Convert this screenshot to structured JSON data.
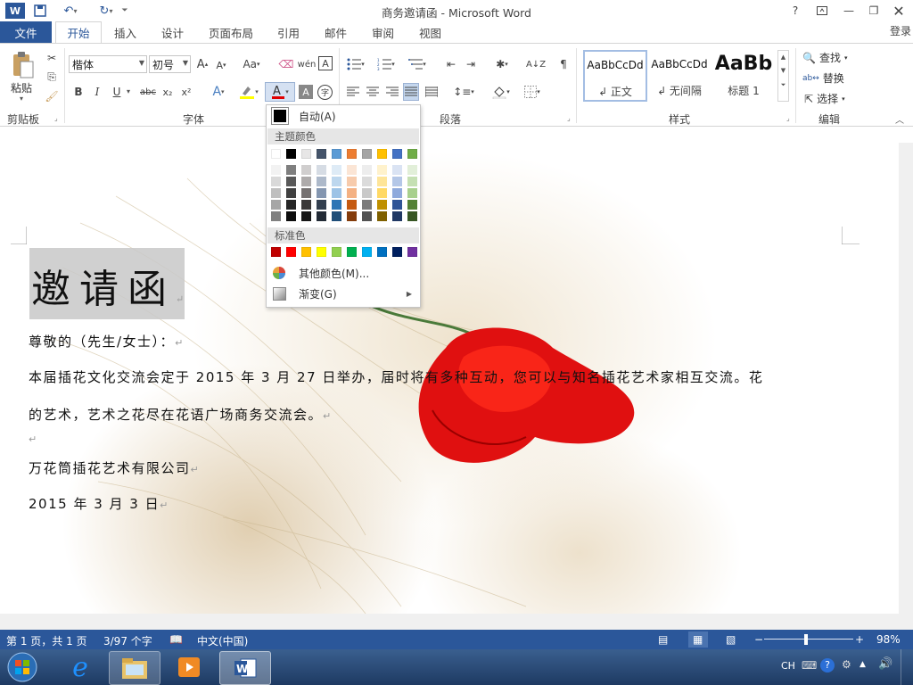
{
  "window": {
    "title": "商务邀请函 - Microsoft Word",
    "quick_access": [
      "W",
      "save",
      "undo",
      "redo",
      "customize"
    ],
    "controls": [
      "?",
      "restore-ribbon",
      "minimize",
      "maximize",
      "close"
    ]
  },
  "tabs": {
    "file": "文件",
    "items": [
      "开始",
      "插入",
      "设计",
      "页面布局",
      "引用",
      "邮件",
      "审阅",
      "视图"
    ],
    "login": "登录"
  },
  "ribbon": {
    "clipboard": {
      "label": "剪贴板",
      "paste": "粘贴"
    },
    "font": {
      "label": "字体",
      "font_name": "楷体",
      "font_size": "初号",
      "grow": "A",
      "shrink": "A",
      "change_case": "Aa",
      "bold": "B",
      "italic": "I",
      "underline": "U",
      "strike": "abc",
      "subscript": "x₂",
      "superscript": "x²"
    },
    "paragraph": {
      "label": "段落"
    },
    "styles": {
      "label": "样式",
      "items": [
        {
          "sample": "AaBbCcDd",
          "name": "↲ 正文"
        },
        {
          "sample": "AaBbCcDd",
          "name": "↲ 无间隔"
        },
        {
          "sample": "AaBb",
          "name": "标题 1"
        }
      ]
    },
    "editing": {
      "label": "编辑",
      "find": "查找",
      "replace": "替换",
      "select": "选择"
    }
  },
  "color_menu": {
    "auto": "自动(A)",
    "theme_header": "主题颜色",
    "standard_header": "标准色",
    "more_colors": "其他颜色(M)...",
    "gradient": "渐变(G)",
    "theme_base": [
      "#ffffff",
      "#000000",
      "#e7e6e6",
      "#44546a",
      "#5b9bd5",
      "#ed7d31",
      "#a5a5a5",
      "#ffc000",
      "#4472c4",
      "#70ad47"
    ],
    "theme_shades": [
      [
        "#f2f2f2",
        "#d9d9d9",
        "#bfbfbf",
        "#a6a6a6",
        "#808080"
      ],
      [
        "#7f7f7f",
        "#595959",
        "#404040",
        "#262626",
        "#0d0d0d"
      ],
      [
        "#d0cece",
        "#aeabab",
        "#757171",
        "#3a3838",
        "#161616"
      ],
      [
        "#d6dce4",
        "#adb9ca",
        "#8496b0",
        "#333f4f",
        "#222a35"
      ],
      [
        "#deebf6",
        "#bdd7ee",
        "#9dc3e6",
        "#2e75b5",
        "#1f4e79"
      ],
      [
        "#fbe5d5",
        "#f7cbac",
        "#f4b183",
        "#c55a11",
        "#843c0b"
      ],
      [
        "#ededed",
        "#dbdbdb",
        "#c9c9c9",
        "#7b7b7b",
        "#525252"
      ],
      [
        "#fff2cc",
        "#fee599",
        "#ffd965",
        "#bf9000",
        "#7f6000"
      ],
      [
        "#dae3f3",
        "#b4c7e7",
        "#8faadc",
        "#2f5496",
        "#203864"
      ],
      [
        "#e2efd9",
        "#c5e0b3",
        "#a8d08d",
        "#538135",
        "#375623"
      ]
    ],
    "standard": [
      "#c00000",
      "#ff0000",
      "#ffc000",
      "#ffff00",
      "#92d050",
      "#00b050",
      "#00b0f0",
      "#0070c0",
      "#002060",
      "#7030a0"
    ]
  },
  "document": {
    "heading": "邀请函",
    "salutation": "尊敬的（先生/女士）：",
    "body1": "本届插花文化交流会定于 2015 年 3 月 27 日举办，届时将有多种互动，您可以与知名插花艺术家相互交流。花",
    "body2": "的艺术，艺术之花尽在花语广场商务交流会。",
    "signature": "万花筒插花艺术有限公司",
    "date": "2015 年 3 月 3 日",
    "paragraph_mark": "↵"
  },
  "status": {
    "page": "第 1 页，共 1 页",
    "words": "3/97 个字",
    "language": "中文(中国)",
    "zoom": "98%"
  },
  "taskbar": {
    "tray_lang": "CH",
    "apps": [
      "start",
      "ie",
      "explorer",
      "media",
      "word"
    ]
  }
}
